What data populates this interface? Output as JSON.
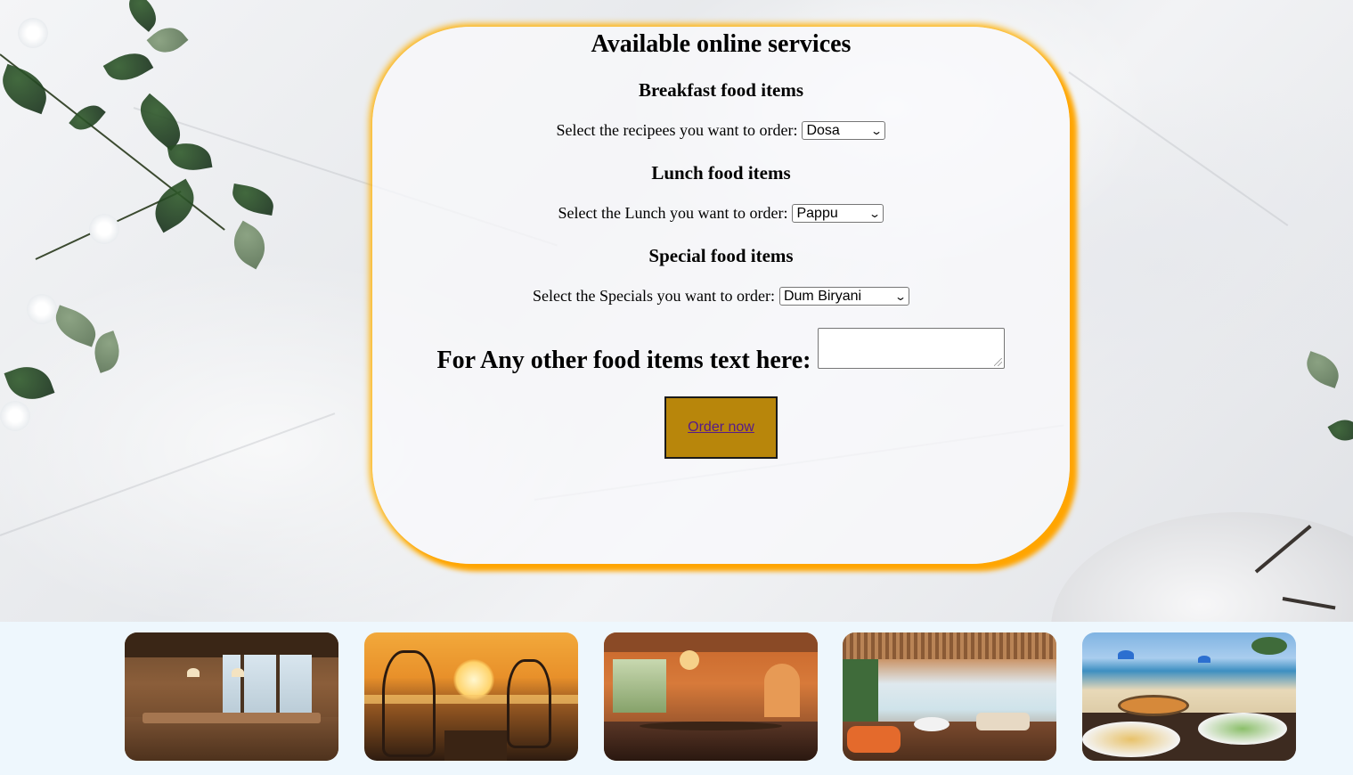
{
  "card": {
    "title": "Available online services",
    "breakfast": {
      "heading": "Breakfast food items",
      "label": "Select the recipees you want to order:",
      "selected": "Dosa"
    },
    "lunch": {
      "heading": "Lunch food items",
      "label": "Select the Lunch you want to order:",
      "selected": "Pappu"
    },
    "special": {
      "heading": "Special food items",
      "label": "Select the Specials you want to order:",
      "selected": "Dum Biryani"
    },
    "other": {
      "label": "For Any other food items text here:",
      "value": ""
    },
    "order_button": "Order now"
  },
  "colors": {
    "card_glow": "#ffa500",
    "button_bg": "#b8860b",
    "link_text": "#551a8b",
    "gallery_bg": "#eef7fd"
  },
  "gallery": [
    {
      "name": "restaurant-interior-wood-photo"
    },
    {
      "name": "beach-sunset-dinner-photo"
    },
    {
      "name": "orange-lounge-interior-photo"
    },
    {
      "name": "seaside-terrace-restaurant-photo"
    },
    {
      "name": "beach-breakfast-table-photo"
    }
  ]
}
